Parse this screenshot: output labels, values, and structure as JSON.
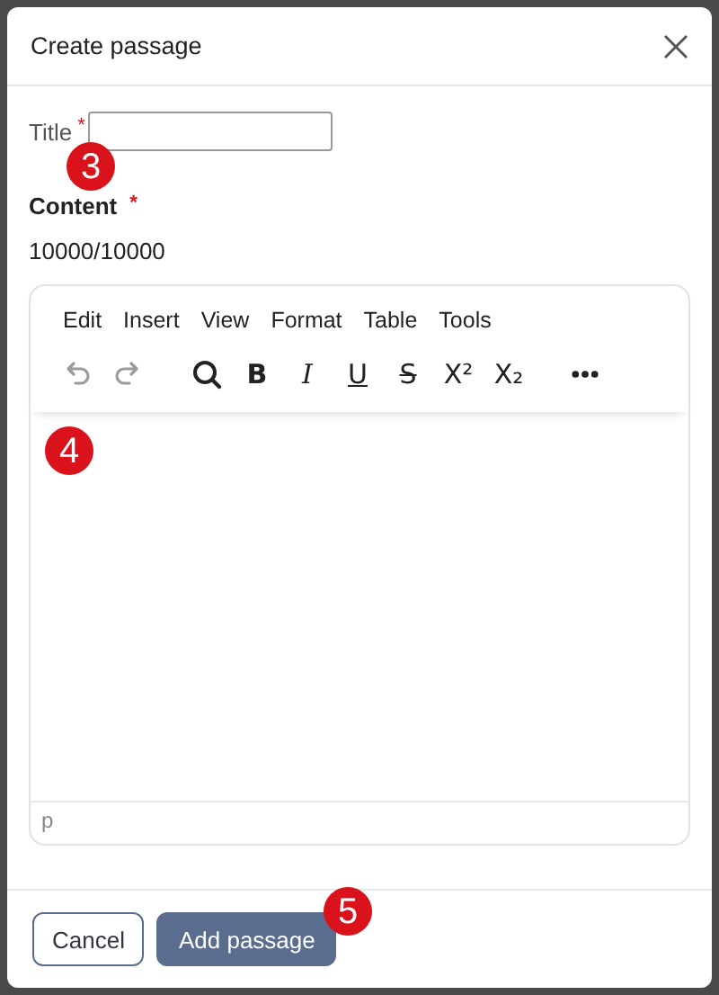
{
  "dialog": {
    "title": "Create passage"
  },
  "title_field": {
    "label": "Title",
    "required_mark": "*"
  },
  "content": {
    "label": "Content",
    "required_mark": "*",
    "counter": "10000/10000"
  },
  "editor": {
    "menu": [
      "Edit",
      "Insert",
      "View",
      "Format",
      "Table",
      "Tools"
    ],
    "toolbar": [
      {
        "kind": "undo",
        "disabled": true
      },
      {
        "kind": "redo",
        "disabled": true
      },
      {
        "kind": "search",
        "disabled": false
      },
      {
        "kind": "bold",
        "label": "B",
        "disabled": false
      },
      {
        "kind": "italic",
        "label": "I",
        "disabled": false
      },
      {
        "kind": "underline",
        "label": "U",
        "disabled": false
      },
      {
        "kind": "strike",
        "label": "S",
        "disabled": false
      },
      {
        "kind": "superscript",
        "label": "X²",
        "disabled": false
      },
      {
        "kind": "subscript",
        "label": "X₂",
        "disabled": false
      },
      {
        "kind": "more",
        "disabled": false
      }
    ],
    "status": "p"
  },
  "buttons": [
    {
      "label": "Cancel",
      "kind": "secondary"
    },
    {
      "label": "Add passage",
      "kind": "primary"
    }
  ],
  "callouts": [
    "3",
    "4",
    "5"
  ]
}
